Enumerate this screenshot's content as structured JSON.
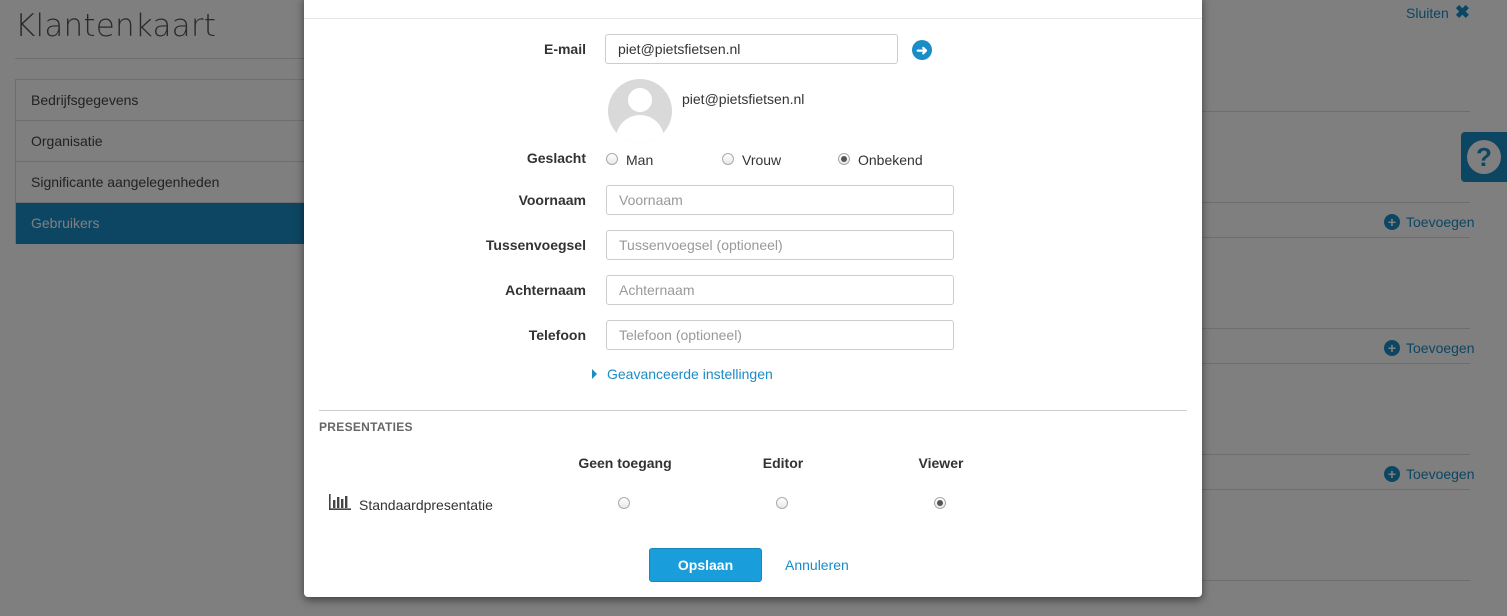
{
  "background": {
    "page_title": "Klantenkaart",
    "close_label": "Sluiten",
    "menu": [
      {
        "label": "Bedrijfsgegevens"
      },
      {
        "label": "Organisatie"
      },
      {
        "label": "Significante aangelegenheden"
      },
      {
        "label": "Gebruikers",
        "active": true
      }
    ],
    "add_labels": [
      "Toevoegen",
      "Toevoegen",
      "Toevoegen"
    ],
    "help_icon": "question-icon"
  },
  "form": {
    "email": {
      "label": "E-mail",
      "value": "piet@pietsfietsen.nl"
    },
    "avatar_email": "piet@pietsfietsen.nl",
    "gender": {
      "label": "Geslacht",
      "options": [
        {
          "label": "Man",
          "checked": false
        },
        {
          "label": "Vrouw",
          "checked": false
        },
        {
          "label": "Onbekend",
          "checked": true
        }
      ]
    },
    "first_name": {
      "label": "Voornaam",
      "placeholder": "Voornaam",
      "value": ""
    },
    "middle_name": {
      "label": "Tussenvoegsel",
      "placeholder": "Tussenvoegsel (optioneel)",
      "value": ""
    },
    "last_name": {
      "label": "Achternaam",
      "placeholder": "Achternaam",
      "value": ""
    },
    "phone": {
      "label": "Telefoon",
      "placeholder": "Telefoon (optioneel)",
      "value": ""
    },
    "advanced_label": "Geavanceerde instellingen"
  },
  "presentations": {
    "section_title": "PRESENTATIES",
    "columns": [
      "Geen toegang",
      "Editor",
      "Viewer"
    ],
    "rows": [
      {
        "name": "Standaardpresentatie",
        "icon": "bar-chart-icon",
        "selected": "Viewer"
      }
    ]
  },
  "actions": {
    "save_label": "Opslaan",
    "cancel_label": "Annuleren"
  },
  "colors": {
    "accent": "#1a8cc6",
    "primary_button": "#1a9ddb"
  }
}
